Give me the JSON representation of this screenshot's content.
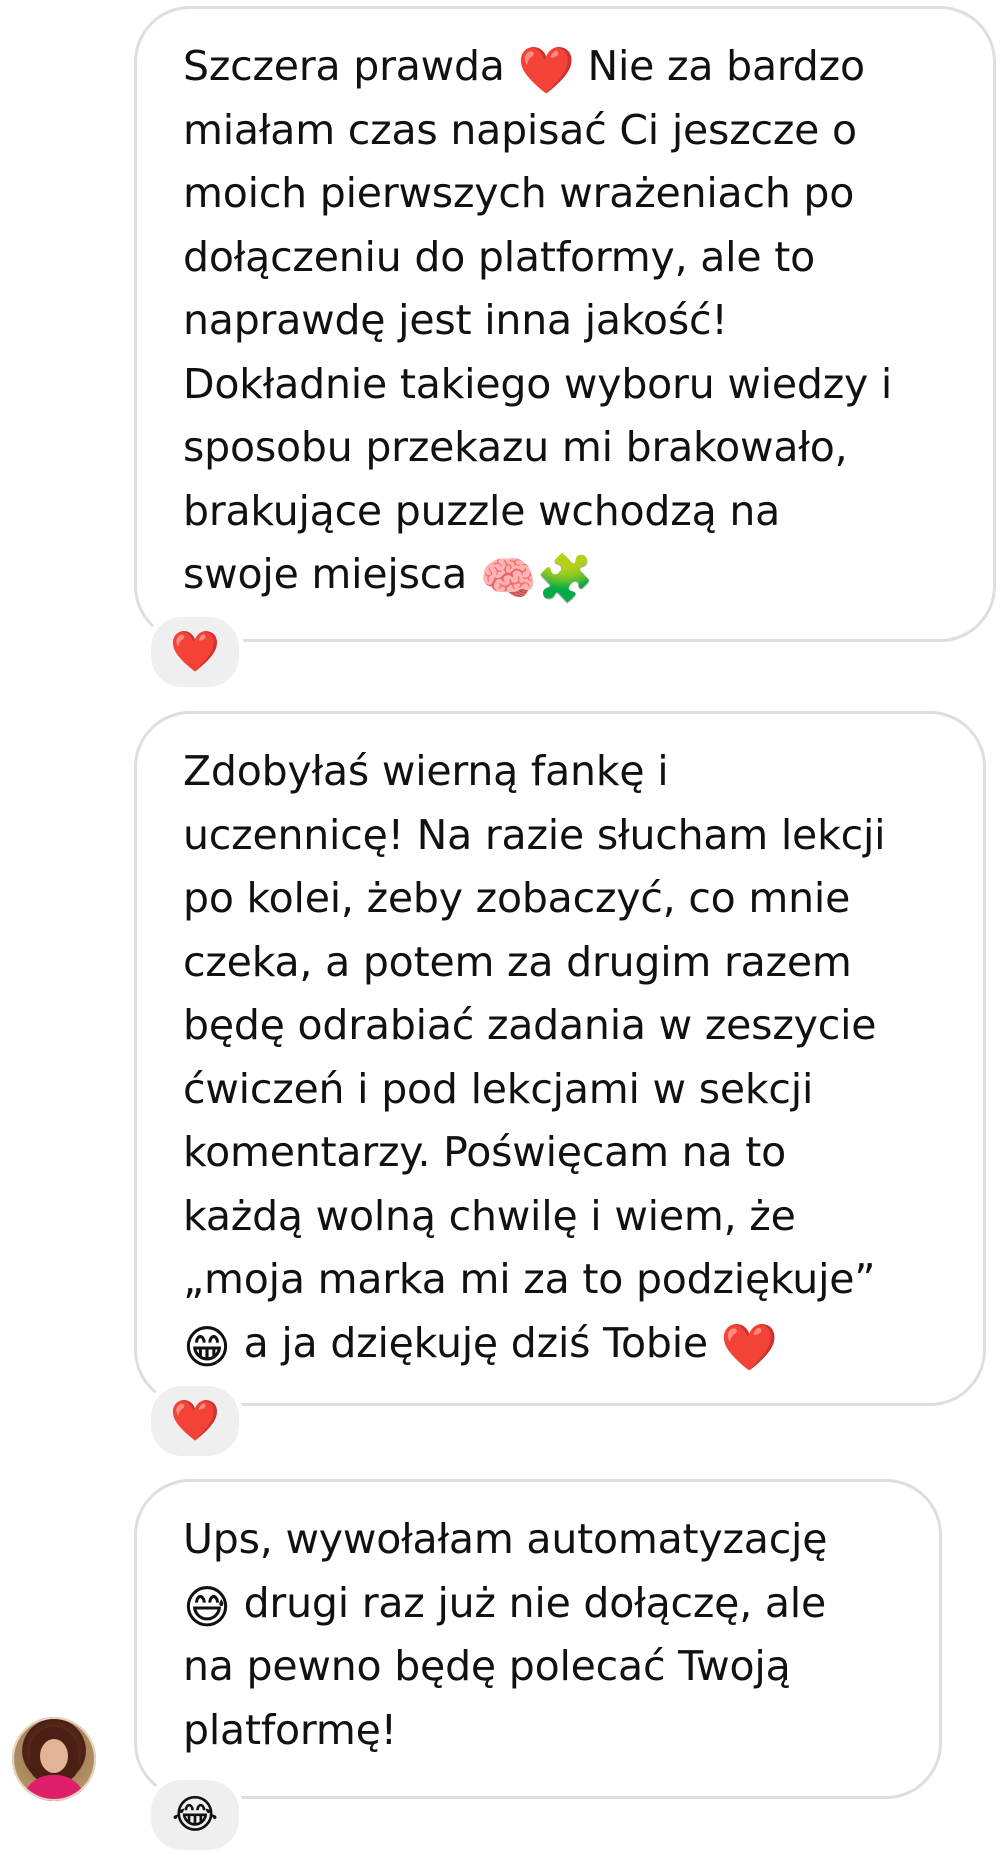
{
  "messages": [
    {
      "lines": [
        "Szczera prawda",
        "miałam czas napisać Ci jeszcze o",
        "moich pierwszych wrażeniach po",
        "dołączeniu do platformy, ale to",
        "naprawdę jest inna jakość!",
        "Dokładnie takiego wyboru wiedzy i",
        "sposobu przekazu mi brakowało,",
        "brakujące puzzle wchodzą na",
        "swoje miejsca"
      ],
      "line1_after_emoji": "Nie za bardzo",
      "inline_emoji": [
        "❤️",
        "🧠",
        "🧩"
      ],
      "reaction": "❤️"
    },
    {
      "lines": [
        "Zdobyłaś wierną fankę i",
        "uczennicę! Na razie słucham lekcji",
        "po kolei, żeby zobaczyć, co mnie",
        "czeka, a potem za drugim razem",
        "będę odrabiać zadania w zeszycie",
        "ćwiczeń i pod lekcjami w sekcji",
        "komentarzy. Poświęcam na to",
        "każdą wolną chwilę i wiem, że",
        "„moja marka mi za to podziękuje”",
        "a ja dziękuję dziś Tobie"
      ],
      "inline_emoji": [
        "😁",
        "❤️"
      ],
      "reaction": "❤️"
    },
    {
      "lines": [
        "Ups, wywołałam automatyzację",
        "drugi raz już nie dołączę, ale",
        "na pewno będę polecać Twoją",
        "platformę!"
      ],
      "inline_emoji": [
        "😅"
      ],
      "reaction": "😂"
    }
  ]
}
